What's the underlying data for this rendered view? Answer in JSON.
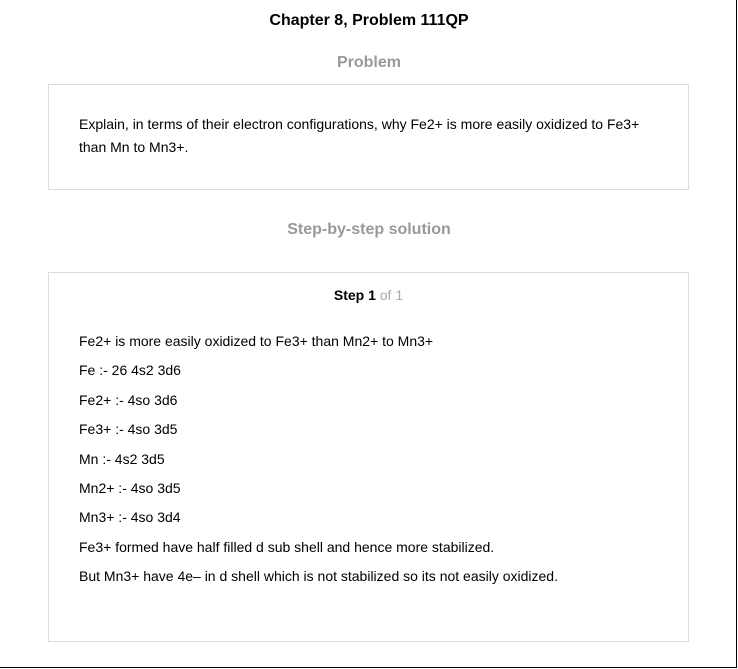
{
  "header": {
    "title": "Chapter 8, Problem 111QP"
  },
  "problem": {
    "heading": "Problem",
    "text": "Explain, in terms of their electron configurations, why Fe2+ is more easily oxidized to Fe3+ than Mn to Mn3+."
  },
  "solution": {
    "heading": "Step-by-step solution",
    "step_label": "Step 1",
    "step_count": "of 1",
    "lines": [
      "Fe2+ is more easily oxidized to Fe3+ than Mn2+ to Mn3+",
      "Fe :- 26 4s2 3d6",
      "Fe2+ :- 4so 3d6",
      "Fe3+ :- 4so 3d5",
      "Mn :- 4s2 3d5",
      "Mn2+ :- 4so 3d5",
      "Mn3+ :- 4so 3d4",
      "Fe3+ formed have half filled d sub shell and hence more stabilized.",
      "But Mn3+ have 4e– in d shell which is not stabilized so its not easily oxidized."
    ]
  }
}
